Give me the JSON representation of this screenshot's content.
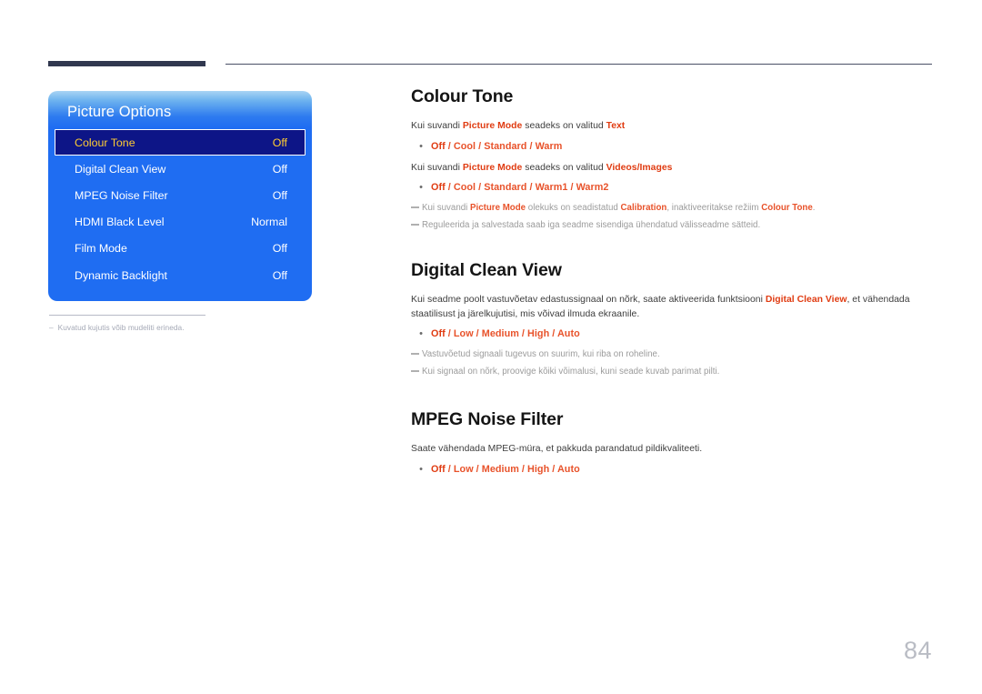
{
  "page": {
    "number": "84",
    "accent_dark": "#31384f",
    "accent_red": "#e8522a",
    "osd_blue": "#1f6df2",
    "osd_selected_bg": "#0d1587",
    "osd_selected_text": "#ffcc33"
  },
  "osd": {
    "title": "Picture Options",
    "rows": [
      {
        "label": "Colour Tone",
        "value": "Off",
        "selected": true
      },
      {
        "label": "Digital Clean View",
        "value": "Off",
        "selected": false
      },
      {
        "label": "MPEG Noise Filter",
        "value": "Off",
        "selected": false
      },
      {
        "label": "HDMI Black Level",
        "value": "Normal",
        "selected": false
      },
      {
        "label": "Film Mode",
        "value": "Off",
        "selected": false
      },
      {
        "label": "Dynamic Backlight",
        "value": "Off",
        "selected": false
      }
    ],
    "caption_dash": "–",
    "caption": "Kuvatud kujutis võib mudeliti erineda."
  },
  "sections": {
    "colour_tone": {
      "title": "Colour Tone",
      "line1_pre": "Kui suvandi ",
      "line1_bold1": "Picture Mode",
      "line1_mid": " seadeks on valitud ",
      "line1_bold2": "Text",
      "bullet1_first": "Off",
      "bullet1_rest": " / Cool / Standard / Warm",
      "line2_pre": "Kui suvandi ",
      "line2_bold1": "Picture Mode",
      "line2_mid": " seadeks on valitud ",
      "line2_bold2": "Videos/Images",
      "bullet2_first": "Off",
      "bullet2_rest": " / Cool / Standard / Warm1 / Warm2",
      "note1_a": "Kui suvandi ",
      "note1_b": "Picture Mode",
      "note1_c": " olekuks on seadistatud ",
      "note1_d": "Calibration",
      "note1_e": ", inaktiveeritakse režiim ",
      "note1_f": "Colour Tone",
      "note1_g": ".",
      "note2": "Reguleerida ja salvestada saab iga seadme sisendiga ühendatud välisseadme sätteid."
    },
    "digital_clean_view": {
      "title": "Digital Clean View",
      "para_a": "Kui seadme poolt vastuvõetav edastussignaal on nõrk, saate aktiveerida funktsiooni ",
      "para_b": "Digital Clean View",
      "para_c": ", et vähendada staatilisust ja järelkujutisi, mis võivad ilmuda ekraanile.",
      "bullet_first": "Off",
      "bullet_rest": " / Low / Medium / High / Auto",
      "note1": "Vastuvõetud signaali tugevus on suurim, kui riba on roheline.",
      "note2": "Kui signaal on nõrk, proovige kõiki võimalusi, kuni seade kuvab parimat pilti."
    },
    "mpeg_noise_filter": {
      "title": "MPEG Noise Filter",
      "para": "Saate vähendada MPEG-müra, et pakkuda parandatud pildikvaliteeti.",
      "bullet_first": "Off",
      "bullet_rest": " / Low / Medium / High / Auto"
    }
  }
}
